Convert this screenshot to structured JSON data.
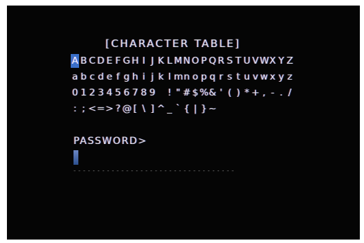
{
  "screen": {
    "title": "[CHARACTER TABLE]",
    "selected_char": "A",
    "rows": [
      [
        "A",
        "B",
        "C",
        "D",
        "E",
        "F",
        "G",
        "H",
        "I",
        "J",
        "K",
        "L",
        "M",
        "N",
        "O",
        "P",
        "Q",
        "R",
        "S",
        "T",
        "U",
        "V",
        "W",
        "X",
        "Y",
        "Z"
      ],
      [
        "a",
        "b",
        "c",
        "d",
        "e",
        "f",
        "g",
        "h",
        "i",
        "j",
        "k",
        "l",
        "m",
        "n",
        "o",
        "p",
        "q",
        "r",
        "s",
        "t",
        "u",
        "v",
        "w",
        "x",
        "y",
        "z"
      ],
      [
        "0",
        "1",
        "2",
        "3",
        "4",
        "5",
        "6",
        "7",
        "8",
        "9",
        " ",
        "!",
        "\"",
        "#",
        "$",
        "%",
        "&",
        "'",
        "(",
        ")",
        "*",
        "+",
        ",",
        "-",
        ".",
        "/"
      ],
      [
        ":",
        ";",
        "<",
        "=",
        ">",
        "?",
        "@",
        "[",
        "\\",
        "]",
        "^",
        "_",
        "`",
        "{",
        "|",
        "}",
        "~"
      ]
    ],
    "prompt": "PASSWORD>",
    "input_value": "",
    "input_underline": "- - - - - - - - - - - - - - - - - - - - - - - - - - - - - - - - - -"
  }
}
